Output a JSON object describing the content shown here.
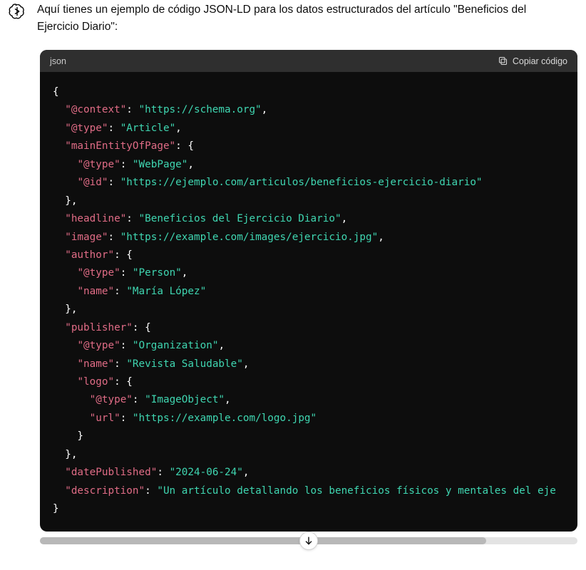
{
  "message": {
    "intro": "Aquí tienes un ejemplo de código JSON-LD para los datos estructurados del artículo \"Beneficios del Ejercicio Diario\":"
  },
  "code_header": {
    "language": "json",
    "copy_label": "Copiar código"
  },
  "code": {
    "lines": [
      [
        {
          "cls": "p",
          "t": "{"
        }
      ],
      [
        {
          "cls": "p",
          "t": "  "
        },
        {
          "cls": "k",
          "t": "\"@context\""
        },
        {
          "cls": "p",
          "t": ": "
        },
        {
          "cls": "s",
          "t": "\"https://schema.org\""
        },
        {
          "cls": "p",
          "t": ","
        }
      ],
      [
        {
          "cls": "p",
          "t": "  "
        },
        {
          "cls": "k",
          "t": "\"@type\""
        },
        {
          "cls": "p",
          "t": ": "
        },
        {
          "cls": "s",
          "t": "\"Article\""
        },
        {
          "cls": "p",
          "t": ","
        }
      ],
      [
        {
          "cls": "p",
          "t": "  "
        },
        {
          "cls": "k",
          "t": "\"mainEntityOfPage\""
        },
        {
          "cls": "p",
          "t": ": {"
        }
      ],
      [
        {
          "cls": "p",
          "t": "    "
        },
        {
          "cls": "k",
          "t": "\"@type\""
        },
        {
          "cls": "p",
          "t": ": "
        },
        {
          "cls": "s",
          "t": "\"WebPage\""
        },
        {
          "cls": "p",
          "t": ","
        }
      ],
      [
        {
          "cls": "p",
          "t": "    "
        },
        {
          "cls": "k",
          "t": "\"@id\""
        },
        {
          "cls": "p",
          "t": ": "
        },
        {
          "cls": "s",
          "t": "\"https://ejemplo.com/articulos/beneficios-ejercicio-diario\""
        }
      ],
      [
        {
          "cls": "p",
          "t": "  },"
        }
      ],
      [
        {
          "cls": "p",
          "t": "  "
        },
        {
          "cls": "k",
          "t": "\"headline\""
        },
        {
          "cls": "p",
          "t": ": "
        },
        {
          "cls": "s",
          "t": "\"Beneficios del Ejercicio Diario\""
        },
        {
          "cls": "p",
          "t": ","
        }
      ],
      [
        {
          "cls": "p",
          "t": "  "
        },
        {
          "cls": "k",
          "t": "\"image\""
        },
        {
          "cls": "p",
          "t": ": "
        },
        {
          "cls": "s",
          "t": "\"https://example.com/images/ejercicio.jpg\""
        },
        {
          "cls": "p",
          "t": ","
        }
      ],
      [
        {
          "cls": "p",
          "t": "  "
        },
        {
          "cls": "k",
          "t": "\"author\""
        },
        {
          "cls": "p",
          "t": ": {"
        }
      ],
      [
        {
          "cls": "p",
          "t": "    "
        },
        {
          "cls": "k",
          "t": "\"@type\""
        },
        {
          "cls": "p",
          "t": ": "
        },
        {
          "cls": "s",
          "t": "\"Person\""
        },
        {
          "cls": "p",
          "t": ","
        }
      ],
      [
        {
          "cls": "p",
          "t": "    "
        },
        {
          "cls": "k",
          "t": "\"name\""
        },
        {
          "cls": "p",
          "t": ": "
        },
        {
          "cls": "s",
          "t": "\"María López\""
        }
      ],
      [
        {
          "cls": "p",
          "t": "  },"
        }
      ],
      [
        {
          "cls": "p",
          "t": "  "
        },
        {
          "cls": "k",
          "t": "\"publisher\""
        },
        {
          "cls": "p",
          "t": ": {"
        }
      ],
      [
        {
          "cls": "p",
          "t": "    "
        },
        {
          "cls": "k",
          "t": "\"@type\""
        },
        {
          "cls": "p",
          "t": ": "
        },
        {
          "cls": "s",
          "t": "\"Organization\""
        },
        {
          "cls": "p",
          "t": ","
        }
      ],
      [
        {
          "cls": "p",
          "t": "    "
        },
        {
          "cls": "k",
          "t": "\"name\""
        },
        {
          "cls": "p",
          "t": ": "
        },
        {
          "cls": "s",
          "t": "\"Revista Saludable\""
        },
        {
          "cls": "p",
          "t": ","
        }
      ],
      [
        {
          "cls": "p",
          "t": "    "
        },
        {
          "cls": "k",
          "t": "\"logo\""
        },
        {
          "cls": "p",
          "t": ": {"
        }
      ],
      [
        {
          "cls": "p",
          "t": "      "
        },
        {
          "cls": "k",
          "t": "\"@type\""
        },
        {
          "cls": "p",
          "t": ": "
        },
        {
          "cls": "s",
          "t": "\"ImageObject\""
        },
        {
          "cls": "p",
          "t": ","
        }
      ],
      [
        {
          "cls": "p",
          "t": "      "
        },
        {
          "cls": "k",
          "t": "\"url\""
        },
        {
          "cls": "p",
          "t": ": "
        },
        {
          "cls": "s",
          "t": "\"https://example.com/logo.jpg\""
        }
      ],
      [
        {
          "cls": "p",
          "t": "    }"
        }
      ],
      [
        {
          "cls": "p",
          "t": "  },"
        }
      ],
      [
        {
          "cls": "p",
          "t": "  "
        },
        {
          "cls": "k",
          "t": "\"datePublished\""
        },
        {
          "cls": "p",
          "t": ": "
        },
        {
          "cls": "s",
          "t": "\"2024-06-24\""
        },
        {
          "cls": "p",
          "t": ","
        }
      ],
      [
        {
          "cls": "p",
          "t": "  "
        },
        {
          "cls": "k",
          "t": "\"description\""
        },
        {
          "cls": "p",
          "t": ": "
        },
        {
          "cls": "s",
          "t": "\"Un artículo detallando los beneficios físicos y mentales del eje"
        }
      ],
      [
        {
          "cls": "p",
          "t": "}"
        }
      ]
    ]
  }
}
